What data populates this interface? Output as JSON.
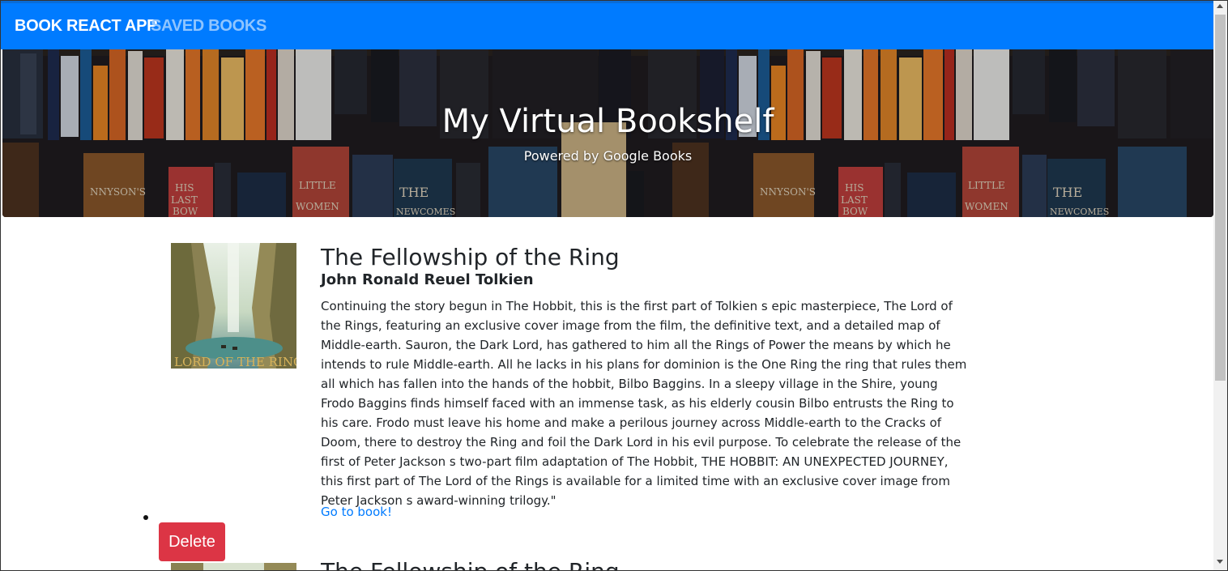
{
  "navbar": {
    "brand": "BOOK REACT APP",
    "saved_link": "SAVED BOOKS"
  },
  "hero": {
    "title": "My Virtual Bookshelf",
    "subtitle": "Powered by Google Books"
  },
  "books": [
    {
      "title": "The Fellowship of the Ring",
      "author": "John Ronald Reuel Tolkien",
      "description": "Continuing the story begun in The Hobbit, this is the first part of Tolkien s epic masterpiece, The Lord of the Rings, featuring an exclusive cover image from the film, the definitive text, and a detailed map of Middle-earth. Sauron, the Dark Lord, has gathered to him all the Rings of Power the means by which he intends to rule Middle-earth. All he lacks in his plans for dominion is the One Ring the ring that rules them all which has fallen into the hands of the hobbit, Bilbo Baggins. In a sleepy village in the Shire, young Frodo Baggins finds himself faced with an immense task, as his elderly cousin Bilbo entrusts the Ring to his care. Frodo must leave his home and make a perilous journey across Middle-earth to the Cracks of Doom, there to destroy the Ring and foil the Dark Lord in his evil purpose. To celebrate the release of the first of Peter Jackson s two-part film adaptation of The Hobbit, THE HOBBIT: AN UNEXPECTED JOURNEY, this first part of The Lord of the Rings is available for a limited time with an exclusive cover image from Peter Jackson s award-winning trilogy.\"",
      "link_label": "Go to book!",
      "delete_label": "Delete",
      "cover_text": "LORD OF THE RINGS"
    },
    {
      "title": "The Fellowship of the Ring"
    }
  ],
  "colors": {
    "navbar": "#007bff",
    "saved_link": "#8fc5ff",
    "link": "#007bff",
    "delete": "#dc3545"
  }
}
